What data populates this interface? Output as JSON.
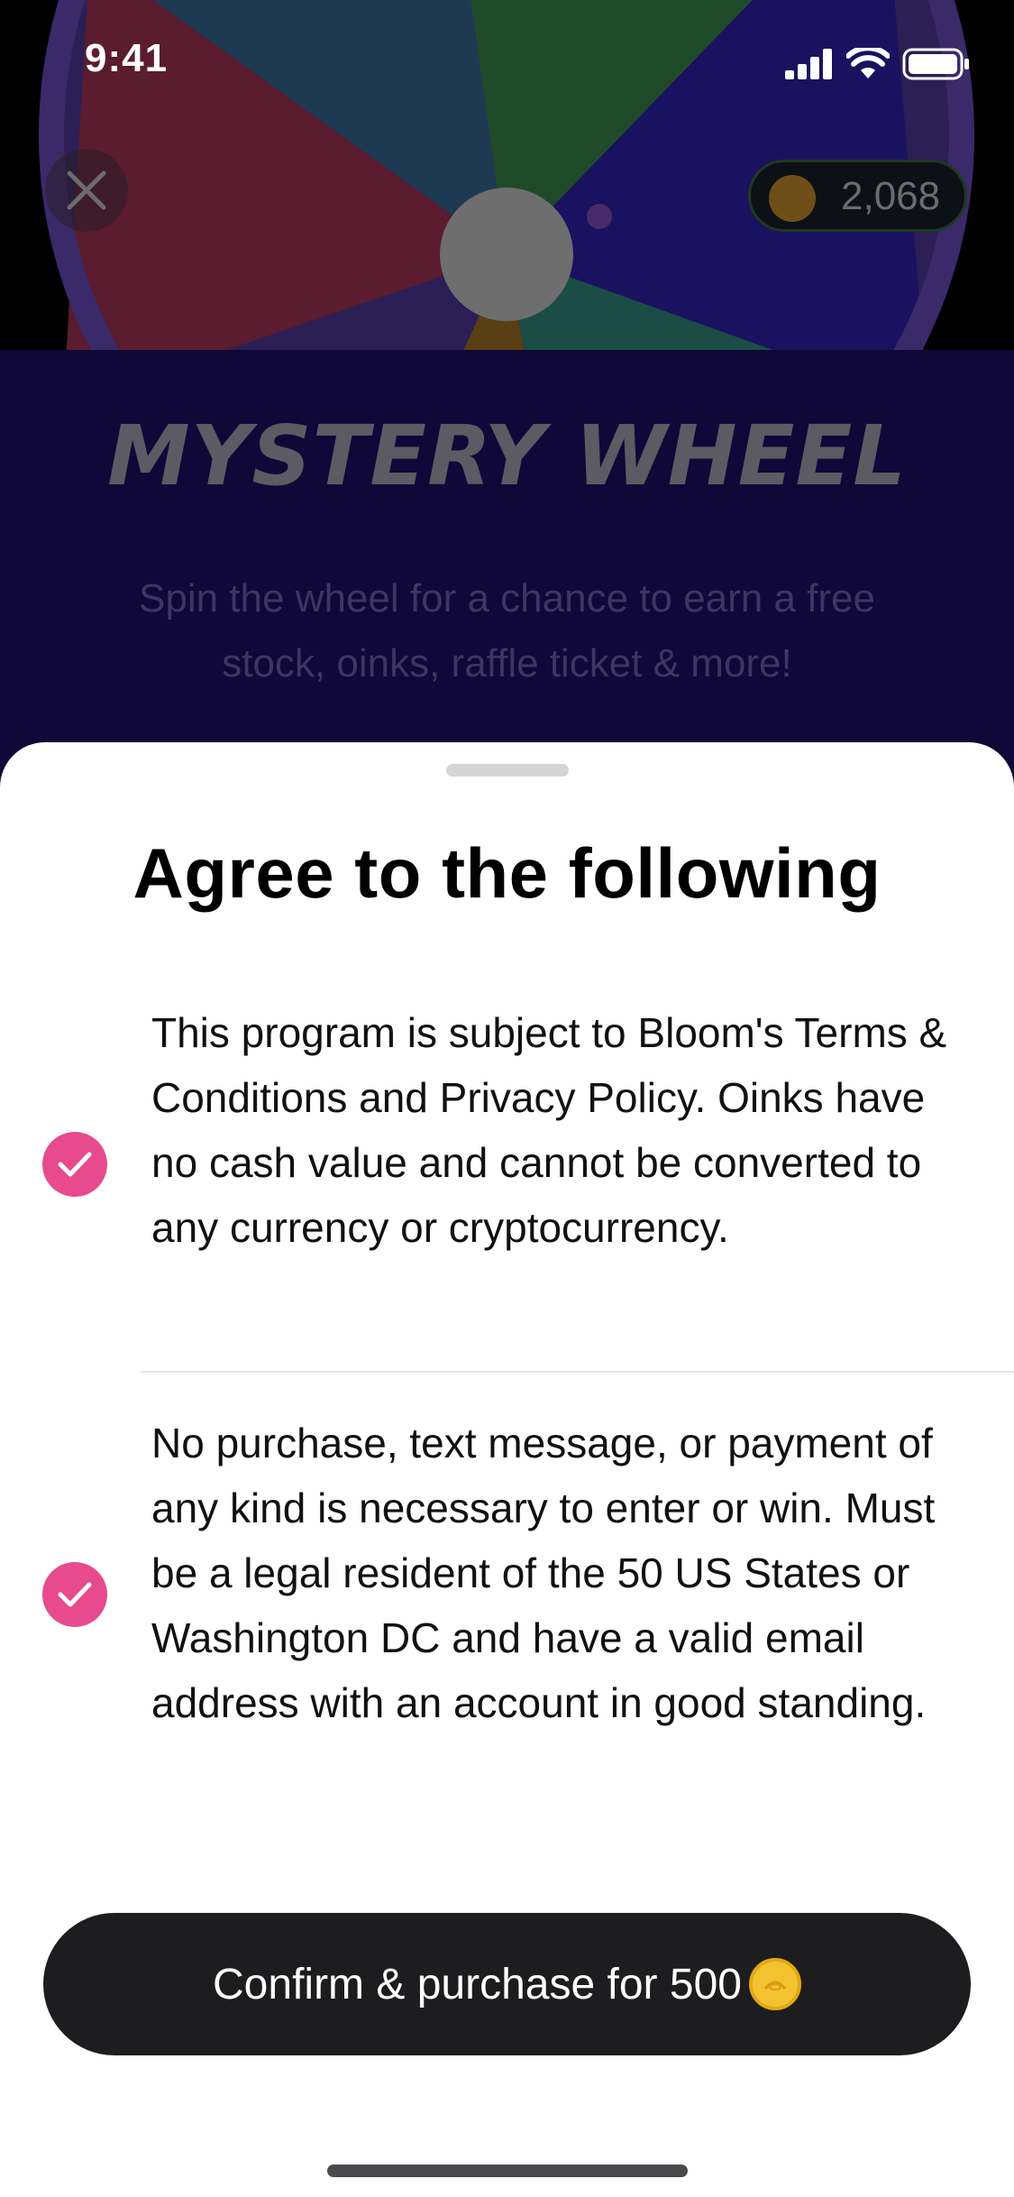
{
  "status_bar": {
    "time": "9:41",
    "icons": [
      "cellular-signal-icon",
      "wifi-icon",
      "battery-icon"
    ]
  },
  "background": {
    "title": "MYSTERY WHEEL",
    "subtitle": "Spin the wheel for a chance to earn a free stock, oinks, raffle ticket & more!",
    "coin_balance": "2,068",
    "close_icon": "close-icon"
  },
  "sheet": {
    "title": "Agree to the following",
    "items": [
      {
        "checked": true,
        "text": "This program is subject to Bloom's Terms & Conditions and Privacy Policy. Oinks have no cash value and cannot be converted to any currency or cryptocurrency."
      },
      {
        "checked": true,
        "text": "No purchase, text message, or payment of any kind is necessary to enter or win. Must be a legal resident of the 50 US States or Washington DC and have a valid email address with an account in good standing."
      }
    ],
    "confirm_label": "Confirm & purchase for 500",
    "confirm_icon": "oink-coin-icon"
  },
  "colors": {
    "accent_check": "#e74a8d",
    "button_bg": "#1d1d1f",
    "coin": "#f3c230"
  }
}
